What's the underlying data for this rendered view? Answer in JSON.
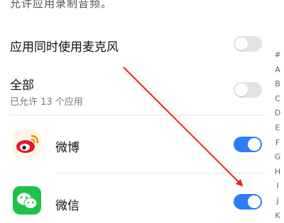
{
  "colors": {
    "accent": "#2f7bff",
    "toggle_off": "#e3e3e3",
    "arrow": "#e8231c",
    "weibo_bg": "#fff5e6",
    "wechat_bg": "#1ec24a"
  },
  "header": {
    "note": "允许应用录制音频。"
  },
  "settings": {
    "simultaneous": {
      "label": "应用同时使用麦克风",
      "enabled": false
    },
    "all": {
      "title": "全部",
      "subtitle": "已允许 13 个应用",
      "enabled": false
    }
  },
  "apps": [
    {
      "name": "微博",
      "icon": "weibo-icon",
      "enabled": true
    },
    {
      "name": "微信",
      "icon": "wechat-icon",
      "enabled": true
    }
  ],
  "index_letters": [
    "#",
    "A",
    "B",
    "C",
    "D",
    "E",
    "F",
    "G",
    "H",
    "I",
    "J",
    "K"
  ]
}
